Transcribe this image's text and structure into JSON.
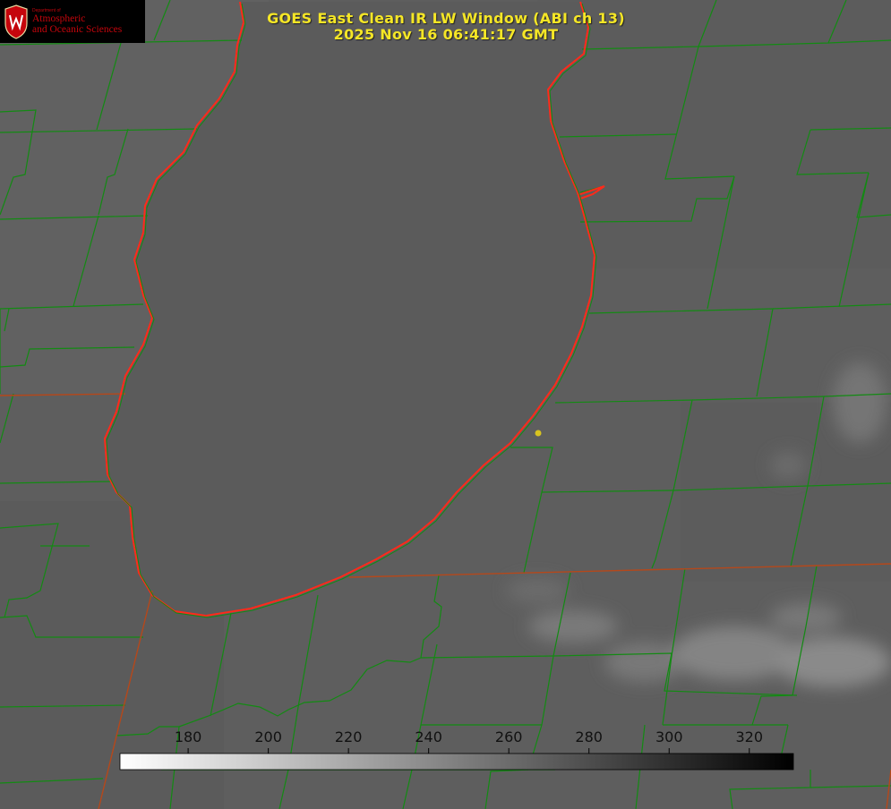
{
  "logo": {
    "department": "Department of",
    "line1": "Atmospheric",
    "line2": "and Oceanic Sciences"
  },
  "title": {
    "line1": "GOES East Clean IR LW Window (ABI ch 13)",
    "line2": "2025 Nov 16 06:41:17 GMT"
  },
  "colorbar": {
    "ticks": [
      "180",
      "200",
      "220",
      "240",
      "260",
      "280",
      "300",
      "320"
    ],
    "min": 163,
    "max": 331,
    "gradient": [
      "#ffffff",
      "#000000"
    ]
  },
  "colors": {
    "background": "#5e5e5e",
    "lake": "#5a5a5a",
    "county_lines": "#138a13",
    "state_lines": "#b5481b",
    "coastline": "#ff2a1a",
    "title_text": "#f5e626",
    "marker": "#d8c41f",
    "logo_text": "#c5050c"
  },
  "map": {
    "layers": [
      "satellite-ir",
      "lake-michigan-coastline",
      "county-boundaries",
      "state-boundaries"
    ],
    "marker_icon": "station-dot-icon"
  }
}
